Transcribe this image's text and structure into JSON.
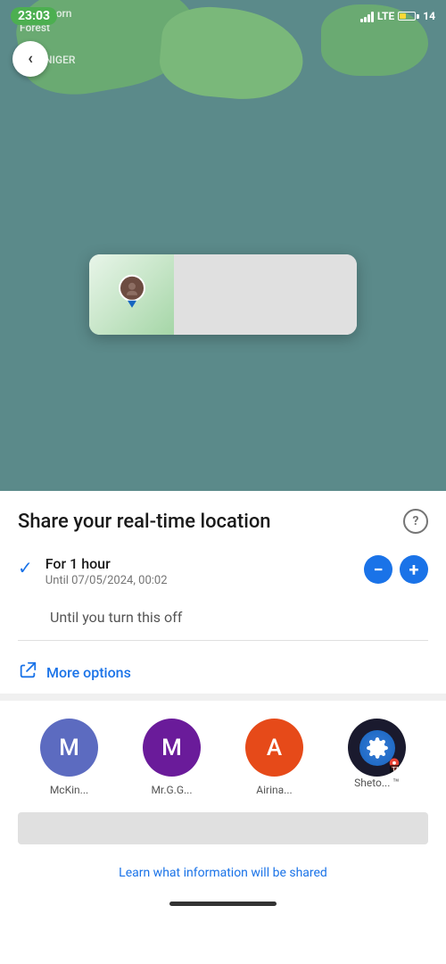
{
  "status_bar": {
    "time": "23:03",
    "signal_label": "LTE",
    "battery_level": "14"
  },
  "map": {
    "land_label1": "Badabhorn",
    "land_label2": "Forest",
    "land_label3": "NIGER"
  },
  "back_button": {
    "label": "‹"
  },
  "sheet": {
    "title": "Share your real-time location",
    "help_icon": "?",
    "option1": {
      "main": "For 1 hour",
      "sub": "Until 07/05/2024, 00:02",
      "checked": true
    },
    "option2": {
      "main": "Until you turn this off"
    },
    "more_options": "More options",
    "learn_link": "Learn what information will be shared"
  },
  "contacts": [
    {
      "initial": "M",
      "color": "#5c6bc0",
      "name": "McKin..."
    },
    {
      "initial": "M",
      "color": "#6a1b9a",
      "name": "Mr.G.G..."
    },
    {
      "initial": "A",
      "color": "#e64a19",
      "name": "Airina..."
    },
    {
      "initial": "⚙",
      "color": "#0d1b2a",
      "name": "Sheto... ™"
    }
  ]
}
